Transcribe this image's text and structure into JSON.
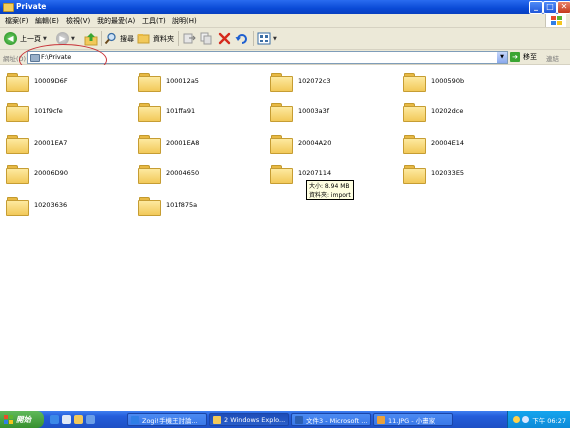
{
  "window": {
    "title": "Private",
    "controls": {
      "minimize": "_",
      "maximize": "□",
      "close": "✕"
    }
  },
  "menu": [
    "檔案(F)",
    "編輯(E)",
    "檢視(V)",
    "我的最愛(A)",
    "工具(T)",
    "說明(H)"
  ],
  "toolbar": {
    "back_label": "上一頁",
    "search_label": "搜尋",
    "folders_label": "資料夾"
  },
  "address": {
    "label": "網址(D)",
    "value": "F:\\Private",
    "go_label": "移至",
    "links_label": "連結"
  },
  "folders": [
    "10009D6F",
    "100012a5",
    "102072c3",
    "1000590b",
    "101f9cfe",
    "101ffa91",
    "10003a3f",
    "10202dce",
    "20001EA7",
    "20001EA8",
    "20004A20",
    "20004E14",
    "20006D90",
    "20004650",
    "10207114",
    "102033E5",
    "10203636",
    "101f875a"
  ],
  "tooltip": {
    "line1": "大小: 8.94 MB",
    "line2": "資料夾: import"
  },
  "taskbar": {
    "start_label": "開始",
    "tasks": [
      {
        "label": "Zogi!手機王討論...",
        "active": false
      },
      {
        "label": "2 Windows Explo...",
        "active": true
      },
      {
        "label": "文件3 - Microsoft ...",
        "active": false
      },
      {
        "label": "11.JPG - 小畫家",
        "active": false
      }
    ],
    "clock": "下午 06:27"
  },
  "colors": {
    "titlebar": "#0a4ad6",
    "folder": "#f2c95a",
    "taskbar": "#245edb",
    "start": "#36902f",
    "annotation": "#c8343a",
    "tooltip_bg": "#ffffe1"
  }
}
